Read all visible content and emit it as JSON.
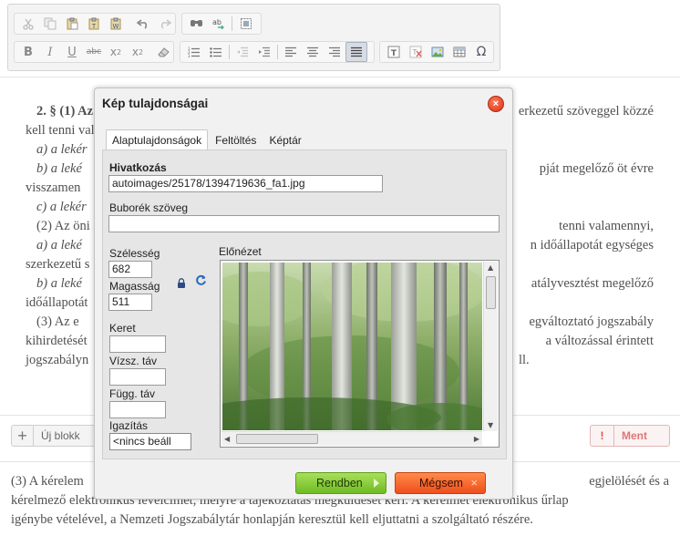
{
  "dialog": {
    "title": "Kép tulajdonságai",
    "close_glyph": "×",
    "tabs": [
      {
        "label": "Alaptulajdonságok",
        "active": true
      },
      {
        "label": "Feltöltés",
        "active": false
      },
      {
        "label": "Képtár",
        "active": false
      }
    ],
    "fields": {
      "link_label": "Hivatkozás",
      "link_value": "autoimages/25178/1394719636_fa1.jpg",
      "tooltip_label": "Buborék szöveg",
      "tooltip_value": "",
      "width_label": "Szélesség",
      "width_value": "682",
      "height_label": "Magasság",
      "height_value": "511",
      "border_label": "Keret",
      "border_value": "",
      "hspace_label": "Vízsz. táv",
      "hspace_value": "",
      "vspace_label": "Függ. táv",
      "vspace_value": "",
      "align_label": "Igazítás",
      "align_value": "<nincs beáll"
    },
    "preview_label": "Előnézet",
    "scroll": {
      "up": "▲",
      "down": "▼",
      "left": "◀",
      "right": "▶"
    },
    "ok_label": "Rendben",
    "cancel_label": "Mégsem",
    "cancel_glyph": "×"
  },
  "block_bar": {
    "plus_glyph": "+",
    "new_block_label": "Új blokk",
    "save_glyph": "!",
    "save_label": "Ment"
  },
  "document": {
    "lines_left": [
      "2. § (1) Az",
      "kell tenni vala",
      "a) a lekér",
      "b) a leké",
      "visszamen",
      "c) a lekér",
      "(2) Az öni",
      "a) a leké",
      "szerkezetű s",
      "b) a leké",
      "időállapotát",
      "(3) Az e",
      "kihirdetését",
      "jogszabályn"
    ],
    "lines_right": [
      "erkezetű szöveggel közzé",
      "",
      "",
      "pját megelőző öt évre",
      "",
      "",
      "tenni valamennyi,",
      "n időállapotát egységes",
      "",
      "atályvesztést megelőző",
      "",
      "egváltoztató jogszabály",
      "a változással érintett",
      "ll."
    ],
    "bottom_lines": [
      "(3) A kérelem",
      "kérelmező elektronikus levélcímét, melyre a tájékoztatás megküldését kéri. A kérelmet elektronikus űrlap",
      "igénybe vételével, a Nemzeti Jogszabálytár honlapján keresztül kell eljuttatni a szolgáltató részére."
    ],
    "bottom_right": "egjelölését és a"
  },
  "colors": {
    "ok_green": "#7cc42c",
    "cancel_orange": "#f25a23",
    "close_red": "#e0461f",
    "save_red": "#e05050"
  }
}
